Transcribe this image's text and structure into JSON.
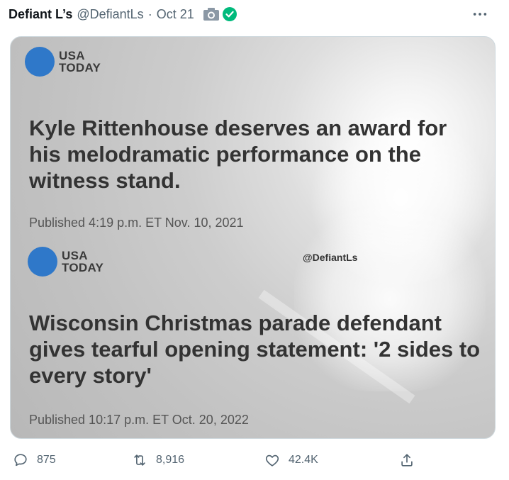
{
  "tweet": {
    "display_name": "Defiant L’s",
    "handle": "@DefiantLs",
    "separator": "·",
    "date": "Oct 21"
  },
  "media": {
    "logo_text_line1": "USA",
    "logo_text_line2": "TODAY",
    "headline1": "Kyle Rittenhouse deserves an award for his melodramatic performance on the witness stand.",
    "published1": "Published 4:19 p.m. ET Nov. 10, 2021",
    "headline2": "Wisconsin Christmas parade defendant gives tearful opening statement: '2 sides to every story'",
    "published2": "Published 10:17 p.m. ET Oct. 20, 2022",
    "watermark": "@DefiantLs"
  },
  "actions": {
    "replies": "875",
    "retweets": "8,916",
    "likes": "42.4K"
  },
  "colors": {
    "verified": "#00ba7c",
    "logo_blue": "#2f78c9",
    "secondary_text": "#536471"
  },
  "icons": [
    "camera-icon",
    "verified-check-icon",
    "more-icon",
    "reply-icon",
    "retweet-icon",
    "like-icon",
    "share-icon"
  ]
}
